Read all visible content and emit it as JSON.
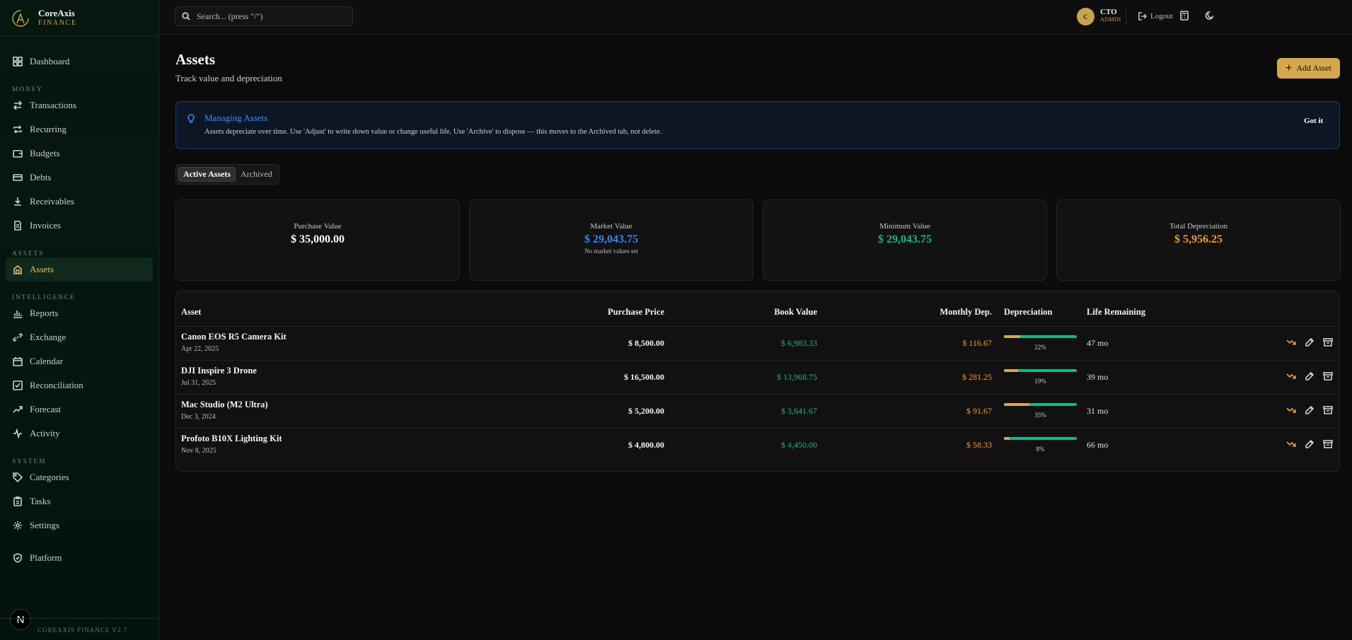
{
  "brand": {
    "name": "CoreAxis",
    "sub": "FINANCE",
    "version": "COREAXIS FINANCE V2.7",
    "badge": "N"
  },
  "sidebar": {
    "dashboard": "Dashboard",
    "money_section": "MONEY",
    "money": [
      "Transactions",
      "Recurring",
      "Budgets",
      "Debts",
      "Receivables",
      "Invoices"
    ],
    "assets_section": "ASSETS",
    "assets": "Assets",
    "intel_section": "INTELLIGENCE",
    "intel": [
      "Reports",
      "Exchange",
      "Calendar",
      "Reconciliation",
      "Forecast",
      "Activity"
    ],
    "system_section": "SYSTEM",
    "system": [
      "Categories",
      "Tasks",
      "Settings"
    ],
    "platform": "Platform"
  },
  "topbar": {
    "search_placeholder": "Search... (press \"/\")",
    "avatar_initial": "C",
    "user_name": "CTO",
    "user_role": "ADMIN",
    "logout": "Logout"
  },
  "page": {
    "title": "Assets",
    "subtitle": "Track value and depreciation",
    "add_button": "Add Asset"
  },
  "tip": {
    "title": "Managing Assets",
    "body": "Assets depreciate over time. Use 'Adjust' to write down value or change useful life. Use 'Archive' to dispose — this moves to the Archived tab, not delete.",
    "button": "Got it"
  },
  "tabs": {
    "active": "Active Assets",
    "archived": "Archived"
  },
  "cards": [
    {
      "label": "Purchase Value",
      "value": "$ 35,000.00",
      "note": "",
      "color": "#ffffff"
    },
    {
      "label": "Market Value",
      "value": "$ 29,043.75",
      "note": "No market values set",
      "color": "#3b82f6"
    },
    {
      "label": "Minimum Value",
      "value": "$ 29,043.75",
      "note": "",
      "color": "#10b981"
    },
    {
      "label": "Total Depreciation",
      "value": "$ 5,956.25",
      "note": "",
      "color": "#f59e0b"
    }
  ],
  "table": {
    "headers": {
      "asset": "Asset",
      "purchase": "Purchase Price",
      "book": "Book Value",
      "monthly": "Monthly Dep.",
      "dep": "Depreciation",
      "life": "Life Remaining"
    },
    "rows": [
      {
        "name": "Canon EOS R5 Camera Kit",
        "date": "Apr 22, 2025",
        "purchase": "$ 8,500.00",
        "book": "$ 6,983.33",
        "monthly": "$ 116.67",
        "pct_label": "22%",
        "pct": 0.22,
        "life": "47 mo"
      },
      {
        "name": "DJI Inspire 3 Drone",
        "date": "Jul 31, 2025",
        "purchase": "$ 16,500.00",
        "book": "$ 13,968.75",
        "monthly": "$ 281.25",
        "pct_label": "19%",
        "pct": 0.19,
        "life": "39 mo"
      },
      {
        "name": "Mac Studio (M2 Ultra)",
        "date": "Dec 3, 2024",
        "purchase": "$ 5,200.00",
        "book": "$ 3,641.67",
        "monthly": "$ 91.67",
        "pct_label": "35%",
        "pct": 0.35,
        "life": "31 mo"
      },
      {
        "name": "Profoto B10X Lighting Kit",
        "date": "Nov 8, 2025",
        "purchase": "$ 4,800.00",
        "book": "$ 4,450.00",
        "monthly": "$ 58.33",
        "pct_label": "8%",
        "pct": 0.08,
        "life": "66 mo"
      }
    ]
  },
  "colors": {
    "accent": "#d4a84c",
    "green": "#10b981",
    "orange": "#f59e0b",
    "blue": "#3b82f6"
  }
}
